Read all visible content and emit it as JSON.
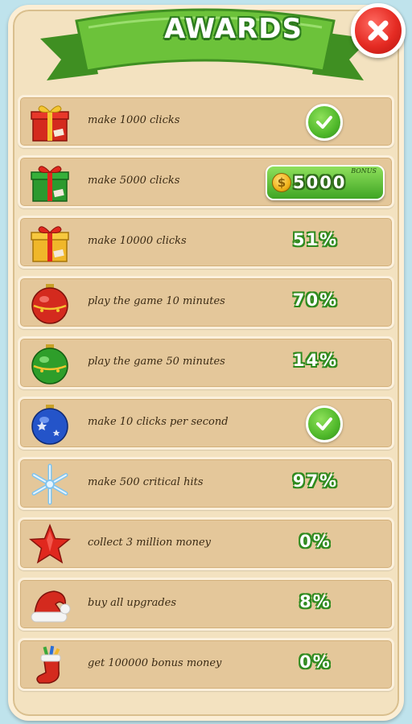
{
  "header": {
    "title": "AWARDS",
    "close_icon": "close-x-icon"
  },
  "colors": {
    "panel_bg": "#f3e2c0",
    "row_bg": "#e4c79a",
    "ribbon_green": "#6cc23a",
    "close_red": "#e52b23",
    "progress_text_outline": "#2f8a1e"
  },
  "awards": [
    {
      "icon": "red-gift-icon",
      "label": "make 1000 clicks",
      "status": "complete"
    },
    {
      "icon": "green-gift-icon",
      "label": "make 5000 clicks",
      "status": "bonus",
      "bonus_tag": "BONUS",
      "bonus_amount": "5000",
      "bonus_icon": "gold-coin-icon"
    },
    {
      "icon": "gold-gift-icon",
      "label": "make 10000 clicks",
      "status": "progress",
      "progress": "51%"
    },
    {
      "icon": "red-ornament-icon",
      "label": "play the game 10 minutes",
      "status": "progress",
      "progress": "70%"
    },
    {
      "icon": "green-ornament-icon",
      "label": "play the game 50 minutes",
      "status": "progress",
      "progress": "14%"
    },
    {
      "icon": "blue-ornament-icon",
      "label": "make 10 clicks per second",
      "status": "complete"
    },
    {
      "icon": "snowflake-icon",
      "label": "make 500 critical hits",
      "status": "progress",
      "progress": "97%"
    },
    {
      "icon": "red-star-icon",
      "label": "collect  3 million money",
      "status": "progress",
      "progress": "0%"
    },
    {
      "icon": "santa-hat-icon",
      "label": "buy all upgrades",
      "status": "progress",
      "progress": "8%"
    },
    {
      "icon": "christmas-stocking-icon",
      "label": "get 100000 bonus money",
      "status": "progress",
      "progress": "0%"
    }
  ]
}
